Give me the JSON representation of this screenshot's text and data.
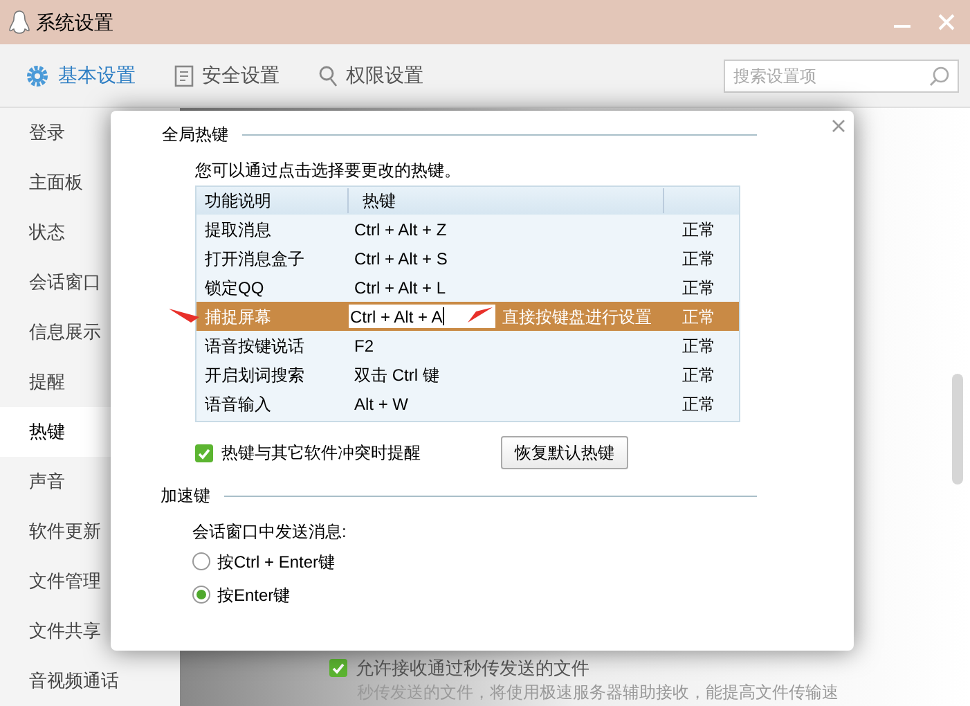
{
  "window": {
    "title": "系统设置"
  },
  "tabs": [
    {
      "label": "基本设置",
      "selected": true
    },
    {
      "label": "安全设置",
      "selected": false
    },
    {
      "label": "权限设置",
      "selected": false
    }
  ],
  "search": {
    "placeholder": "搜索设置项"
  },
  "sidebar": {
    "items": [
      {
        "label": "登录",
        "selected": false
      },
      {
        "label": "主面板",
        "selected": false
      },
      {
        "label": "状态",
        "selected": false
      },
      {
        "label": "会话窗口",
        "selected": false
      },
      {
        "label": "信息展示",
        "selected": false
      },
      {
        "label": "提醒",
        "selected": false
      },
      {
        "label": "热键",
        "selected": true
      },
      {
        "label": "声音",
        "selected": false
      },
      {
        "label": "软件更新",
        "selected": false
      },
      {
        "label": "文件管理",
        "selected": false
      },
      {
        "label": "文件共享",
        "selected": false
      },
      {
        "label": "音视频通话",
        "selected": false
      }
    ]
  },
  "background_content": {
    "checkbox": {
      "label": "允许接收通过秒传发送的文件",
      "checked": true
    },
    "description": "秒传发送的文件，将使用极速服务器辅助接收，能提高文件传输速"
  },
  "dialog": {
    "global_hotkeys": {
      "title": "全局热键",
      "hint": "您可以通过点击选择要更改的热键。",
      "columns": [
        "功能说明",
        "热键"
      ],
      "rows": [
        {
          "function": "提取消息",
          "hotkey": "Ctrl + Alt + Z",
          "status": "正常",
          "selected": false
        },
        {
          "function": "打开消息盒子",
          "hotkey": "Ctrl + Alt + S",
          "status": "正常",
          "selected": false
        },
        {
          "function": "锁定QQ",
          "hotkey": "Ctrl + Alt + L",
          "status": "正常",
          "selected": false
        },
        {
          "function": "捕捉屏幕",
          "hotkey": "Ctrl + Alt + A",
          "status": "正常",
          "selected": true,
          "editing_hint": "直接按键盘进行设置"
        },
        {
          "function": "语音按键说话",
          "hotkey": "F2",
          "status": "正常",
          "selected": false
        },
        {
          "function": "开启划词搜索",
          "hotkey": "双击 Ctrl 键",
          "status": "正常",
          "selected": false
        },
        {
          "function": "语音输入",
          "hotkey": "Alt + W",
          "status": "正常",
          "selected": false
        }
      ],
      "conflict_check": {
        "label": "热键与其它软件冲突时提醒",
        "checked": true
      },
      "reset_button": "恢复默认热键"
    },
    "accelerator": {
      "title": "加速键",
      "prompt": "会话窗口中发送消息:",
      "options": [
        {
          "label": "按Ctrl + Enter键",
          "selected": false
        },
        {
          "label": "按Enter键",
          "selected": true
        }
      ]
    }
  }
}
